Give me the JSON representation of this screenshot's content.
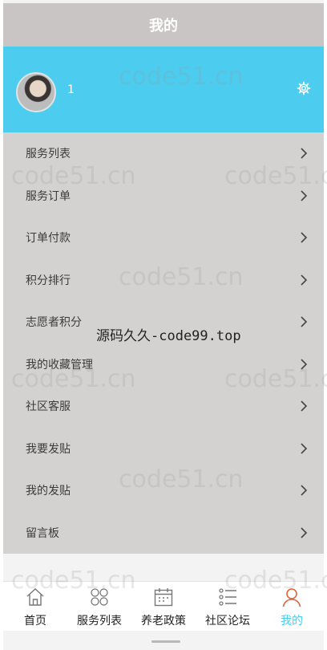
{
  "header": {
    "title": "我的"
  },
  "profile": {
    "username": "1",
    "avatar_icon": "user-avatar",
    "settings_icon": "gear-icon"
  },
  "menu": {
    "items": [
      {
        "label": "服务列表"
      },
      {
        "label": "服务订单"
      },
      {
        "label": "订单付款"
      },
      {
        "label": "积分排行"
      },
      {
        "label": "志愿者积分"
      },
      {
        "label": "我的收藏管理"
      },
      {
        "label": "社区客服"
      },
      {
        "label": "我要发贴"
      },
      {
        "label": "我的发贴"
      },
      {
        "label": "留言板"
      }
    ]
  },
  "tabbar": {
    "tabs": [
      {
        "label": "首页",
        "icon": "home-icon"
      },
      {
        "label": "服务列表",
        "icon": "grid-icon"
      },
      {
        "label": "养老政策",
        "icon": "calendar-icon"
      },
      {
        "label": "社区论坛",
        "icon": "list-icon"
      },
      {
        "label": "我的",
        "icon": "user-icon"
      }
    ],
    "active": "我的"
  },
  "watermarks": {
    "text": "code51.cn",
    "center": "源码久久-code99.top"
  },
  "colors": {
    "accent": "#4ccdf0",
    "header_bg": "#c9c5c4",
    "menu_bg": "#d4d2d1"
  }
}
